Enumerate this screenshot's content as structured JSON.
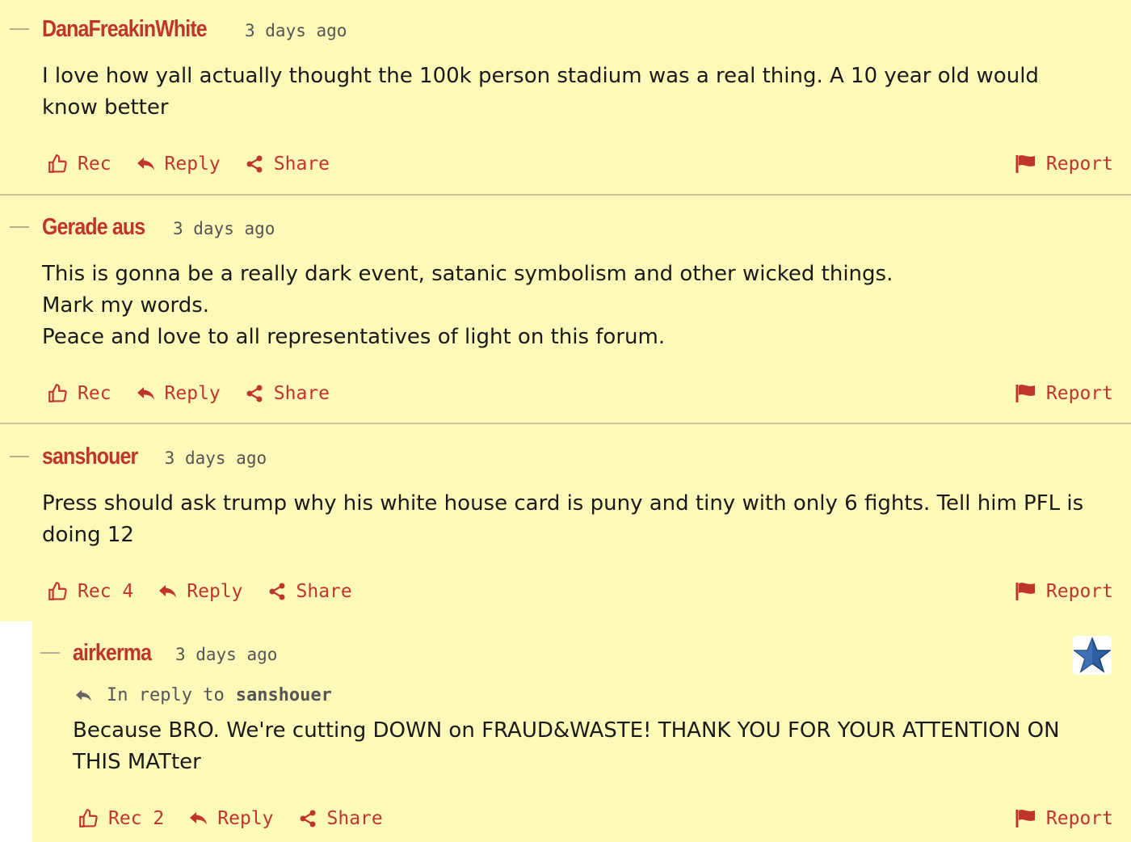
{
  "actions": {
    "rec": "Rec",
    "reply": "Reply",
    "share": "Share",
    "report": "Report"
  },
  "comments": [
    {
      "author": "DanaFreakinWhite",
      "time": "3 days ago",
      "text": "I love how yall actually thought the 100k person stadium was a real thing. A 10 year old would\nknow better",
      "rec_label": "Rec"
    },
    {
      "author": "Gerade aus",
      "time": "3 days ago",
      "text": "This is gonna be a really dark event, satanic symbolism and other wicked things.\nMark my words.\nPeace and love to all representatives of light on this forum.",
      "rec_label": "Rec"
    },
    {
      "author": "sanshouer",
      "time": "3 days ago",
      "text": "Press should ask trump why his white house card is puny and tiny with only 6 fights. Tell him PFL is\ndoing 12",
      "rec_label": "Rec 4"
    },
    {
      "author": "airkerma",
      "time": "3 days ago",
      "in_reply_prefix": "In reply to",
      "in_reply_name": "sanshouer",
      "text": "Because BRO. We're cutting DOWN on FRAUD&WASTE! THANK YOU FOR YOUR ATTENTION ON\nTHIS MATter",
      "rec_label": "Rec 2",
      "badge_icon": "blue-star-icon"
    }
  ],
  "colors": {
    "background": "#fdf9b8",
    "accent": "#c0352a",
    "badge_star": "#2d5fa0"
  }
}
